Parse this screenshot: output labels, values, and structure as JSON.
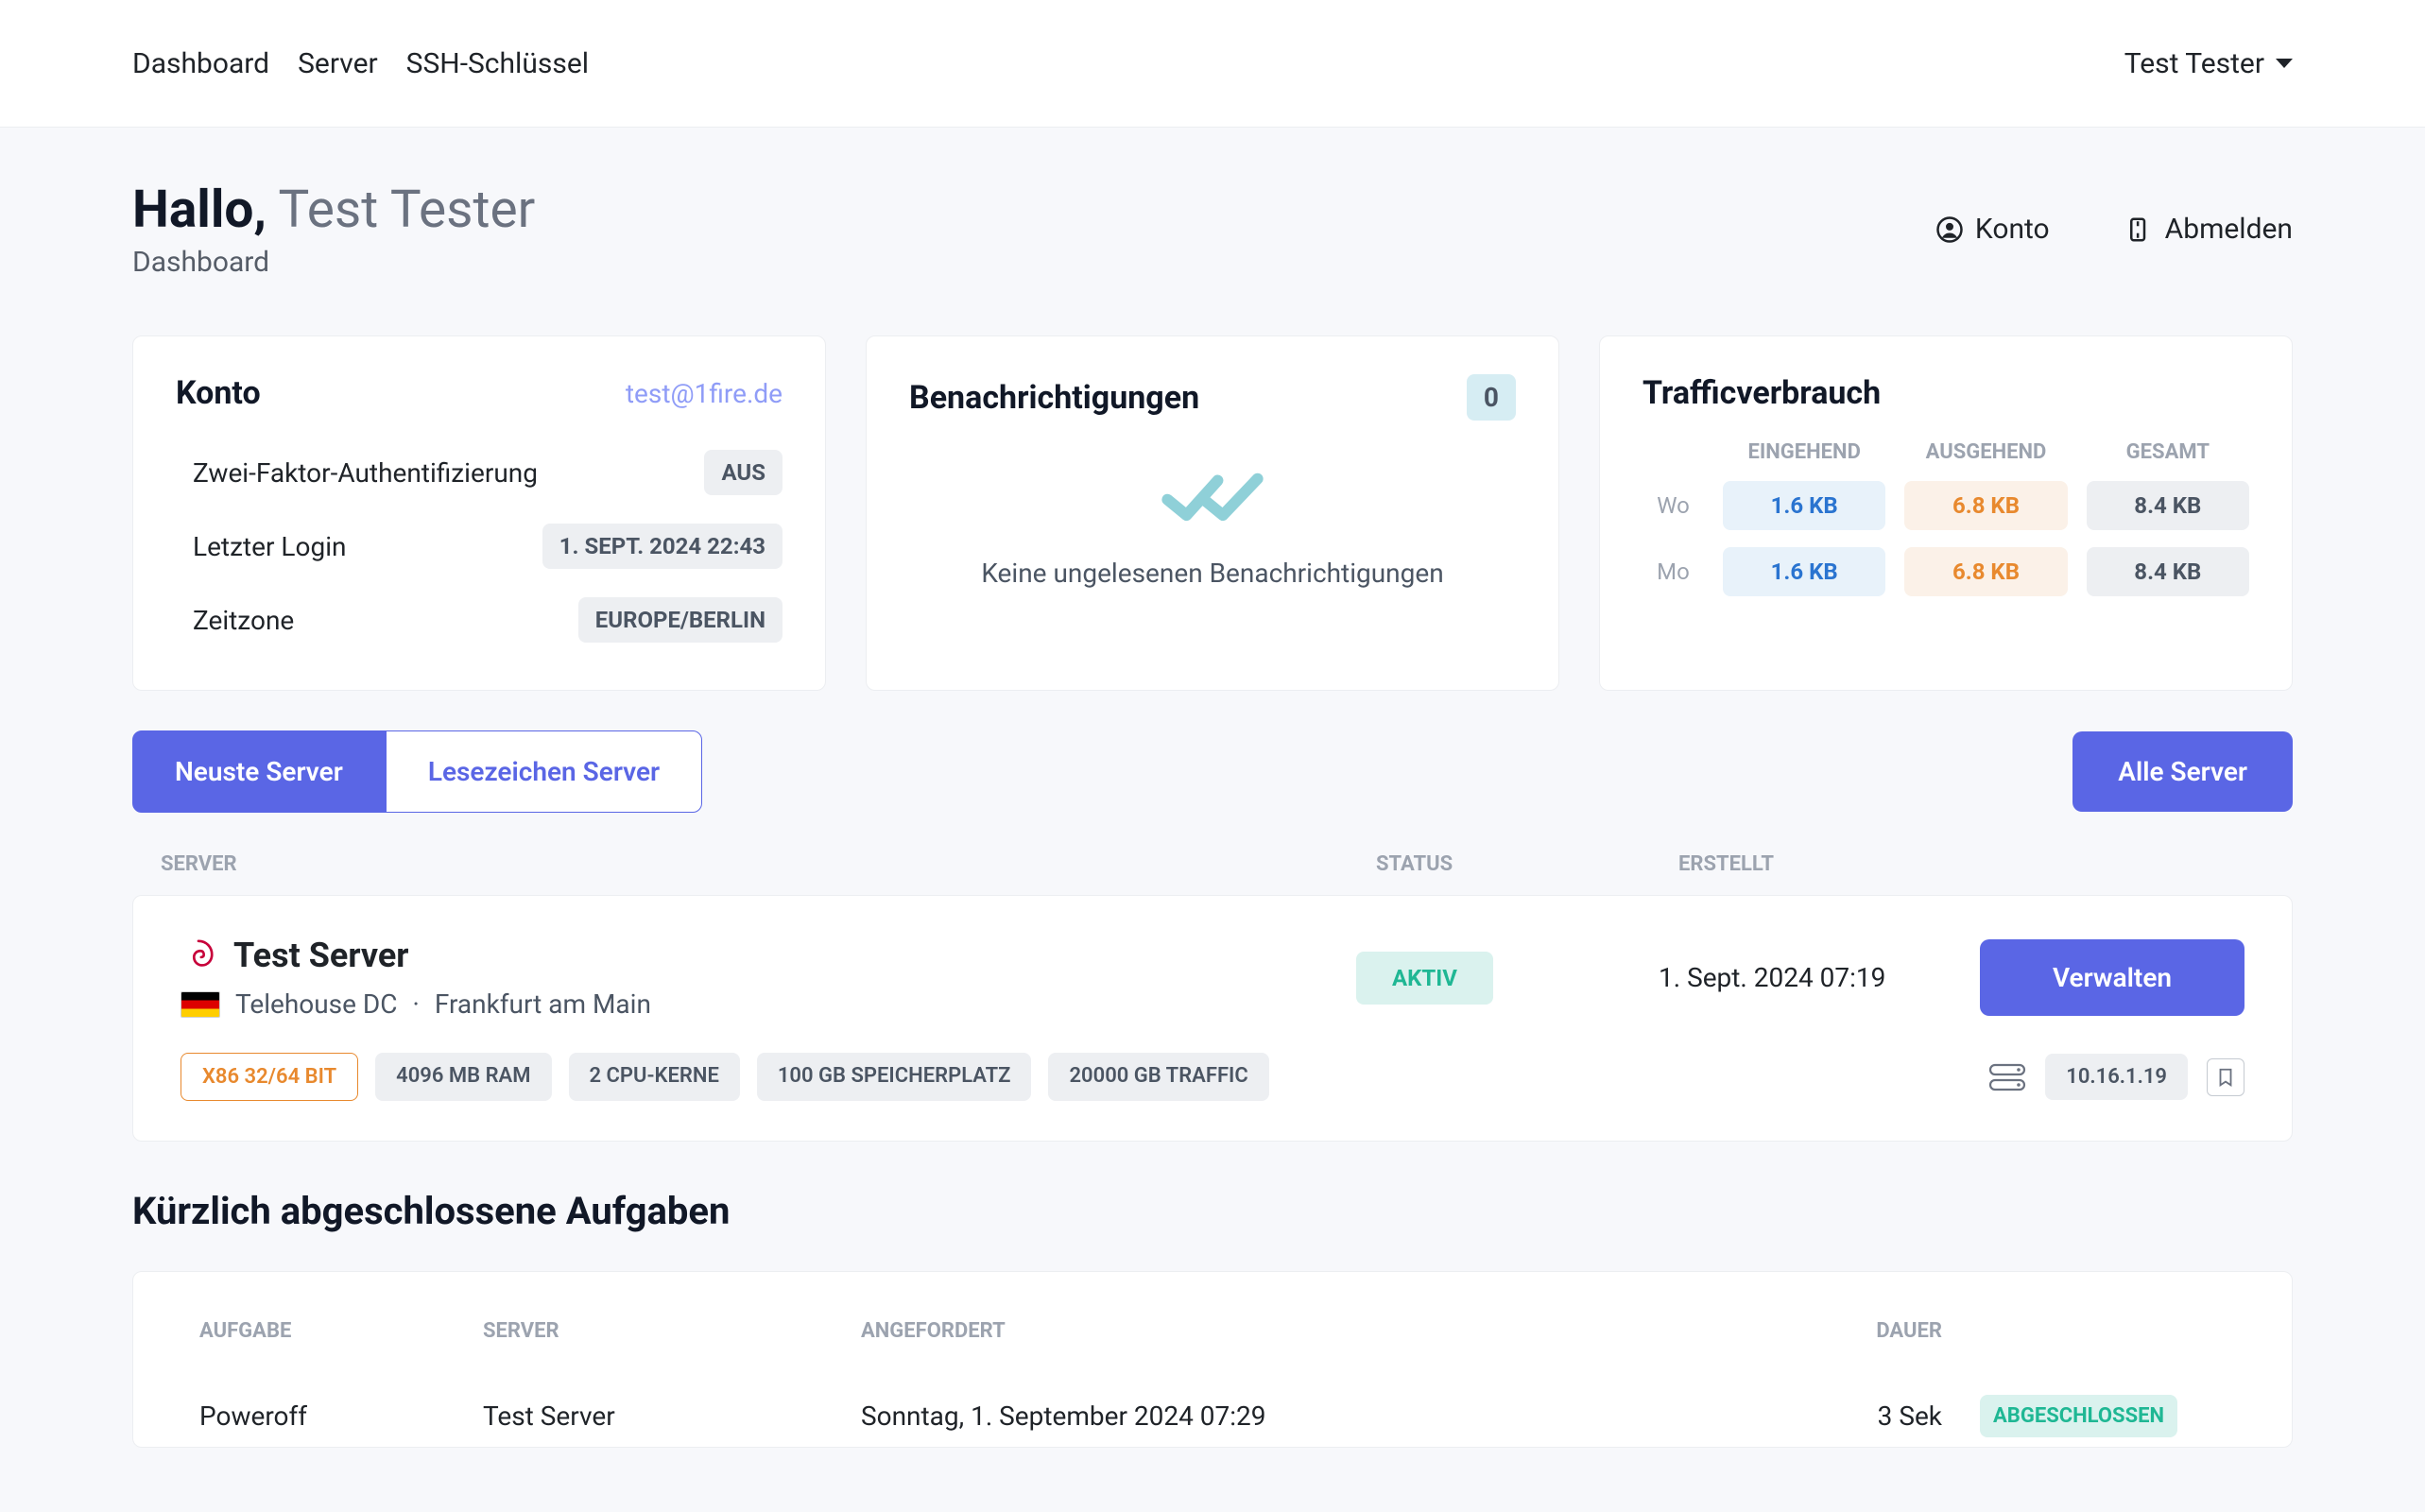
{
  "nav": {
    "dashboard": "Dashboard",
    "server": "Server",
    "ssh": "SSH-Schlüssel",
    "user": "Test Tester"
  },
  "header": {
    "greeting_pre": "Hallo,",
    "greeting_name": "Test Tester",
    "crumb": "Dashboard",
    "account": "Konto",
    "logout": "Abmelden"
  },
  "account_card": {
    "title": "Konto",
    "email": "test@1fire.de",
    "two_factor_label": "Zwei-Faktor-Authentifizierung",
    "two_factor_value": "AUS",
    "last_login_label": "Letzter Login",
    "last_login_value": "1. SEPT. 2024 22:43",
    "timezone_label": "Zeitzone",
    "timezone_value": "EUROPE/BERLIN"
  },
  "notif_card": {
    "title": "Benachrichtigungen",
    "count": "0",
    "empty": "Keine ungelesenen Benachrichtigungen"
  },
  "traffic_card": {
    "title": "Trafficverbrauch",
    "head_in": "EINGEHEND",
    "head_out": "AUSGEHEND",
    "head_sum": "GESAMT",
    "rows": [
      {
        "period": "Wo",
        "in": "1.6 KB",
        "out": "6.8 KB",
        "sum": "8.4 KB"
      },
      {
        "period": "Mo",
        "in": "1.6 KB",
        "out": "6.8 KB",
        "sum": "8.4 KB"
      }
    ]
  },
  "tabs": {
    "newest": "Neuste Server",
    "bookmarked": "Lesezeichen Server",
    "all": "Alle Server"
  },
  "list_head": {
    "server": "SERVER",
    "status": "STATUS",
    "created": "ERSTELLT"
  },
  "server": {
    "name": "Test Server",
    "loc_dc": "Telehouse DC",
    "loc_sep": "·",
    "loc_city": "Frankfurt am Main",
    "status": "AKTIV",
    "created": "1. Sept. 2024 07:19",
    "manage": "Verwalten",
    "arch": "X86 32/64 BIT",
    "ram": "4096 MB RAM",
    "cpu": "2 CPU-KERNE",
    "disk": "100 GB SPEICHERPLATZ",
    "traffic": "20000 GB TRAFFIC",
    "ip": "10.16.1.19"
  },
  "tasks": {
    "title": "Kürzlich abgeschlossene Aufgaben",
    "head_task": "AUFGABE",
    "head_server": "SERVER",
    "head_requested": "ANGEFORDERT",
    "head_duration": "DAUER",
    "row": {
      "task": "Poweroff",
      "server": "Test Server",
      "requested": "Sonntag, 1. September 2024 07:29",
      "duration": "3 Sek",
      "status": "ABGESCHLOSSEN"
    }
  }
}
